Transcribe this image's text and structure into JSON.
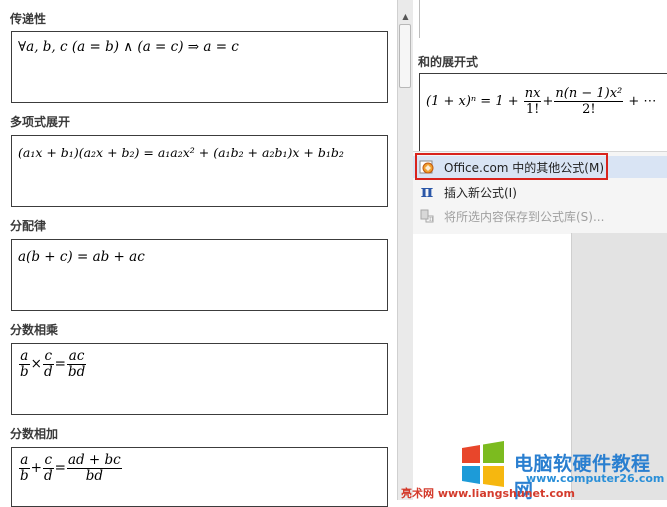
{
  "gallery": {
    "transitive": {
      "title": "传递性",
      "formula": "∀a, b, c (a = b) ∧ (a = c) ⇒ a = c"
    },
    "polynomial": {
      "title": "多项式展开",
      "formula": "(a₁x + b₁)(a₂x + b₂) = a₁a₂x² + (a₁b₂ + a₂b₁)x + b₁b₂"
    },
    "distributive": {
      "title": "分配律",
      "formula": "a(b + c) = ab + ac"
    },
    "frac_multiply": {
      "title": "分数相乘",
      "a": "a",
      "b": "b",
      "c": "c",
      "d": "d",
      "op": "×",
      "eq": "=",
      "num": "ac",
      "den": "bd"
    },
    "frac_add": {
      "title": "分数相加",
      "a": "a",
      "b": "b",
      "c": "c",
      "d": "d",
      "op": "+",
      "eq": "=",
      "num": "ad + bc",
      "den": "bd"
    }
  },
  "right": {
    "binomial": {
      "title": "和的展开式",
      "lhs": "(1 + x)ⁿ = 1 +",
      "f1_num": "nx",
      "f1_den": "1!",
      "plus": "+",
      "f2_num": "n(n − 1)x²",
      "f2_den": "2!",
      "tail": "+ ⋯"
    }
  },
  "menu": {
    "office_more": "Office.com 中的其他公式(M)",
    "insert_new": "插入新公式(I)",
    "save_selection": "将所选内容保存到公式库(S)..."
  },
  "watermark": {
    "brand": "电脑软硬件教程网",
    "url": "www.computer26.com",
    "footer": "亮术网 www.liangshunet.com"
  },
  "colors": {
    "menu_highlight": "#d9e4f4",
    "highlight_border": "#d9231d",
    "pi_icon": "#2b57a8",
    "brand_blue": "#2a7fd0"
  },
  "icons": {
    "office": "office-formula-icon",
    "insert": "pi-icon",
    "save": "save-formula-icon",
    "scroll": "scroll-up-icon"
  }
}
